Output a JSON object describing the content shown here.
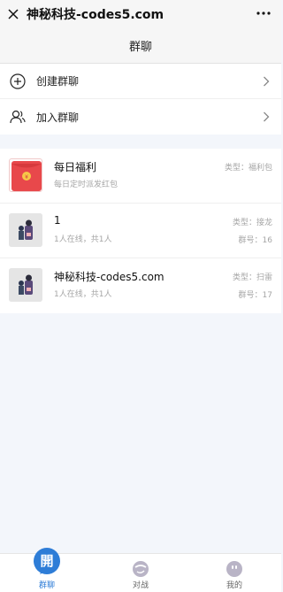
{
  "window": {
    "title": "神秘科技-codes5.com",
    "close_icon": "close-icon",
    "more_icon": "more-dots-icon"
  },
  "header": {
    "title": "群聊"
  },
  "menu": {
    "items": [
      {
        "label": "创建群聊",
        "icon": "plus-circle-icon"
      },
      {
        "label": "加入群聊",
        "icon": "add-user-icon"
      }
    ]
  },
  "groups": [
    {
      "name": "每日福利",
      "subtitle": "每日定时派发红包",
      "type": "类型：福利包",
      "number": "",
      "avatar": "red-envelope-icon"
    },
    {
      "name": "1",
      "subtitle": "1人在线，共1人",
      "type": "类型：接龙",
      "number": "群号：16",
      "avatar": "group-avatar-icon"
    },
    {
      "name": "神秘科技-codes5.com",
      "subtitle": "1人在线，共1人",
      "type": "类型：扫雷",
      "number": "群号：17",
      "avatar": "group-avatar-icon"
    }
  ],
  "tabbar": {
    "tabs": [
      {
        "label": "群聊",
        "icon": "open-badge-icon",
        "badge_text": "開",
        "active": true
      },
      {
        "label": "对战",
        "icon": "battle-icon",
        "active": false
      },
      {
        "label": "我的",
        "icon": "profile-icon",
        "active": false
      }
    ]
  },
  "colors": {
    "accent": "#2e7dd7",
    "red_envelope": "#e8484b",
    "background": "#f3f6fb"
  }
}
